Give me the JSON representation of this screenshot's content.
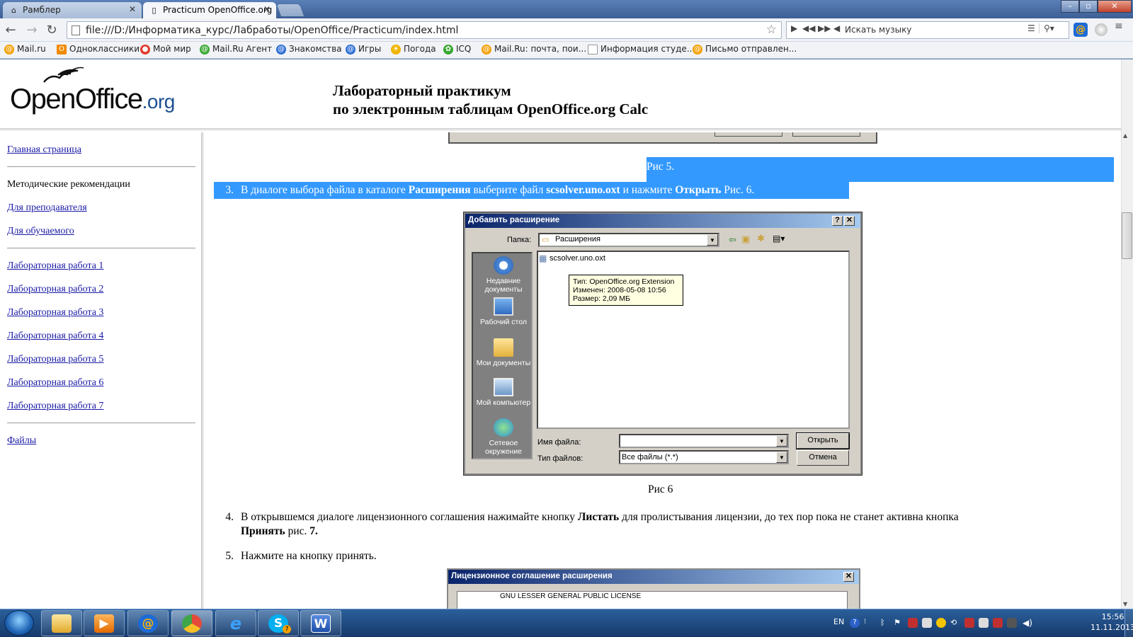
{
  "tabs": [
    {
      "label": "Рамблер",
      "icon": "home-icon"
    },
    {
      "label": "Practicum OpenOffice.org",
      "icon": "page-icon"
    }
  ],
  "toolbar": {
    "url": "file:///D:/Информатика_курс/Лабработы/OpenOffice/Practicum/index.html",
    "music_search": "Искать музыку"
  },
  "bookmarks": [
    {
      "label": "Mail.ru",
      "color": "#f5a000"
    },
    {
      "label": "Одноклассники",
      "color": "#f28a00"
    },
    {
      "label": "Мой мир",
      "color": "#e03e2d"
    },
    {
      "label": "Mail.Ru Агент",
      "color": "#3aa832"
    },
    {
      "label": "Знакомства",
      "color": "#2c6ed4"
    },
    {
      "label": "Игры",
      "color": "#2c6ed4"
    },
    {
      "label": "Погода",
      "color": "#f0b400"
    },
    {
      "label": "ICQ",
      "color": "#3aa832"
    },
    {
      "label": "Mail.Ru: почта, пои...",
      "color": "#f5a000"
    },
    {
      "label": "Информация студе...",
      "color": "#999999"
    },
    {
      "label": "Письмо отправлен...",
      "color": "#f5a000"
    }
  ],
  "header": {
    "logo_main": "OpenOffice",
    "logo_suffix": ".org",
    "title_line1": "Лабораторный практикум",
    "title_line2": "по электронным таблицам OpenOffice.org Calc"
  },
  "sidebar": {
    "home": "Главная страница",
    "method_heading": "Методические рекомендации",
    "for_teacher": "Для преподавателя",
    "for_student": "Для обучаемого",
    "labs": [
      "Лабораторная работа 1",
      "Лабораторная работа 2",
      "Лабораторная работа 3",
      "Лабораторная работа 4",
      "Лабораторная работа 5",
      "Лабораторная работа 6",
      "Лабораторная работа 7"
    ],
    "files": "Файлы"
  },
  "content": {
    "caption5": "Рис 5.",
    "item3_num": "3.",
    "item3_a": "В диалоге выбора файла в каталоге ",
    "item3_b": "Расширения",
    "item3_c": " выберите файл ",
    "item3_d": "scsolver.uno.oxt",
    "item3_e": " и нажмите ",
    "item3_f": "Открыть",
    "item3_g": " Рис. 6.",
    "caption6": "Рис 6",
    "item4_num": "4.",
    "item4_a": "В открывшемся диалоге лицензионного соглашения нажимайте кнопку ",
    "item4_b": "Листать",
    "item4_c": " для пролистывания лицензии, до тех пор пока не станет активна кнопка",
    "item4_d": "Принять",
    "item4_e": " рис. ",
    "item4_f": "7.",
    "item5_num": "5.",
    "item5": "Нажмите на кнопку принять."
  },
  "dialog": {
    "title": "Добавить расширение",
    "help": "?",
    "close": "✕",
    "folder_label": "Папка:",
    "folder_value": "Расширения",
    "places": [
      "Недавние документы",
      "Рабочий стол",
      "Мои документы",
      "Мой компьютер",
      "Сетевое окружение"
    ],
    "file_name": "scsolver.uno.oxt",
    "tooltip": [
      "Тип: OpenOffice.org Extension",
      "Изменен: 2008-05-08 10:56",
      "Размер: 2,09 МБ"
    ],
    "filename_label": "Имя файла:",
    "filetype_label": "Тип файлов:",
    "filetype_value": "Все файлы (*.*)",
    "open_button": "Открыть",
    "cancel_button": "Отмена"
  },
  "dialog2": {
    "title": "Лицензионное соглашение расширения",
    "close": "✕",
    "text": "GNU LESSER GENERAL PUBLIC LICENSE"
  },
  "taskbar": {
    "lang": "EN",
    "time": "15:56",
    "date": "11.11.2013",
    "skype_badge": "7"
  }
}
